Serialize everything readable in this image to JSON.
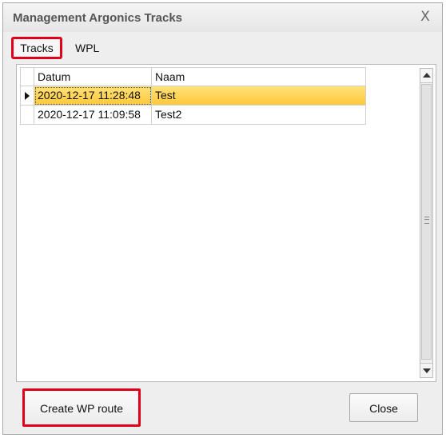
{
  "window": {
    "title": "Management Argonics Tracks",
    "close_glyph": "X"
  },
  "tabs": [
    {
      "label": "Tracks",
      "active": true
    },
    {
      "label": "WPL",
      "active": false
    }
  ],
  "grid": {
    "columns": [
      "Datum",
      "Naam"
    ],
    "rows": [
      {
        "datum": "2020-12-17 11:28:48",
        "naam": "Test",
        "selected": true
      },
      {
        "datum": "2020-12-17 11:09:58",
        "naam": "Test2",
        "selected": false
      }
    ]
  },
  "buttons": {
    "create_wp_route": "Create WP route",
    "close": "Close"
  },
  "colors": {
    "selection": "#ffc83a",
    "highlight": "#e0001a"
  },
  "icons": {
    "row_indicator": "triangle-right-icon",
    "scroll_up": "arrow-up-icon",
    "scroll_down": "arrow-down-icon",
    "close": "close-icon"
  }
}
